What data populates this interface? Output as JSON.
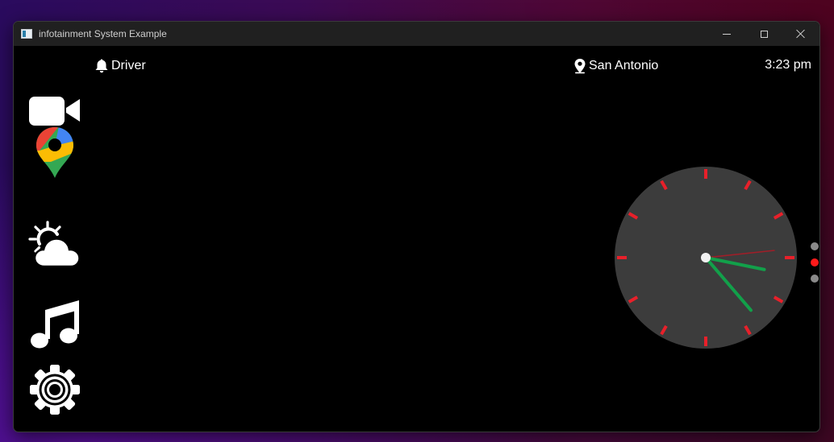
{
  "window": {
    "title": "infotainment System Example",
    "controls": [
      "minimize",
      "maximize",
      "close"
    ]
  },
  "status_bar": {
    "driver_label": "Driver",
    "location": "San Antonio",
    "time": "3:23 pm"
  },
  "sidebar": {
    "items": [
      {
        "icon": "video-camera-icon"
      },
      {
        "icon": "google-maps-pin-icon"
      },
      {
        "icon": "partly-cloudy-weather-icon"
      },
      {
        "icon": "music-note-icon"
      },
      {
        "icon": "settings-gear-icon"
      }
    ]
  },
  "clock": {
    "hour": 3,
    "minute": 23,
    "second": 14,
    "colors": {
      "face": "#3c3c3c",
      "ticks": "#e8202a",
      "hands": "#12a04a",
      "second_hand": "#a01e28",
      "center": "#f2f2f2"
    }
  },
  "page_indicator": {
    "count": 3,
    "active_index": 1,
    "colors": {
      "active": "#ff1a1a",
      "inactive": "#8a8a8a"
    }
  }
}
